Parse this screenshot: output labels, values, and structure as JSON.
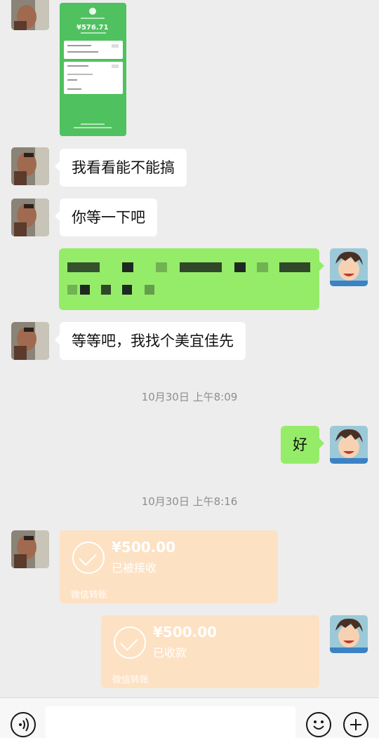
{
  "screenshot": {
    "amount": "¥576.71"
  },
  "messages": [
    {
      "id": "m1",
      "text": "我看看能不能搞"
    },
    {
      "id": "m2",
      "text": "你等一下吧"
    },
    {
      "id": "m4",
      "text": "等等吧，我找个美宜佳先"
    },
    {
      "id": "m5",
      "text": "好"
    }
  ],
  "timestamps": [
    "10月30日 上午8:09",
    "10月30日 上午8:16"
  ],
  "transfers": [
    {
      "amount": "¥500.00",
      "status": "已被接收",
      "footer": "微信转账"
    },
    {
      "amount": "¥500.00",
      "status": "已收款",
      "footer": "微信转账"
    }
  ],
  "icons": {
    "voice": "voice-icon",
    "emoji": "emoji-icon",
    "plus": "plus-icon"
  },
  "colors": {
    "self_bubble": "#95ec69",
    "transfer_card": "#fde1c3",
    "screenshot_green": "#4fc15f"
  }
}
